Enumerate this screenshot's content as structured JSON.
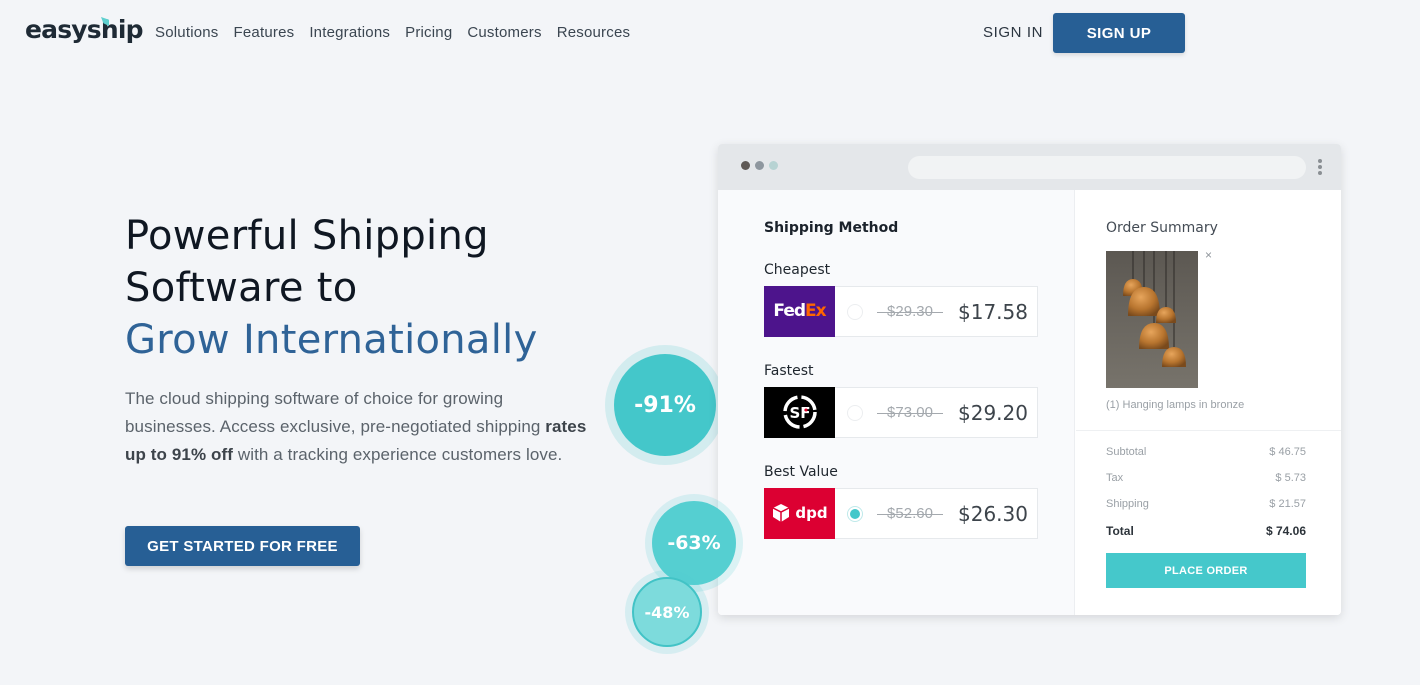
{
  "nav": {
    "logo": "easyship",
    "links": [
      "Solutions",
      "Features",
      "Integrations",
      "Pricing",
      "Customers",
      "Resources"
    ],
    "sign_in": "SIGN IN",
    "sign_up": "SIGN UP"
  },
  "hero": {
    "title_line1": "Powerful Shipping",
    "title_line2": "Software to",
    "title_line3": "Grow Internationally",
    "desc_part1": "The cloud shipping software of choice for growing businesses. Access exclusive, pre-negotiated shipping ",
    "desc_bold": "rates up to 91% off",
    "desc_part2": " with a tracking experience customers love.",
    "cta": "GET STARTED FOR FREE"
  },
  "badges": [
    "-91%",
    "-63%",
    "-48%"
  ],
  "shipping_method": {
    "title": "Shipping Method",
    "options": [
      {
        "label": "Cheapest",
        "carrier": "FedEx",
        "carrier_color": "#4d148c",
        "old_price": "$29.30",
        "price": "$17.58",
        "selected": false
      },
      {
        "label": "Fastest",
        "carrier": "SF",
        "carrier_color": "#000000",
        "old_price": "$73.00",
        "price": "$29.20",
        "selected": false
      },
      {
        "label": "Best Value",
        "carrier": "dpd",
        "carrier_color": "#dc0032",
        "old_price": "$52.60",
        "price": "$26.30",
        "selected": true
      }
    ]
  },
  "order_summary": {
    "title": "Order Summary",
    "close": "×",
    "item_caption": "(1) Hanging lamps in bronze",
    "lines": [
      {
        "label": "Subtotal",
        "value": "$ 46.75"
      },
      {
        "label": "Tax",
        "value": "$ 5.73"
      },
      {
        "label": "Shipping",
        "value": "$ 21.57"
      },
      {
        "label": "Total",
        "value": "$ 74.06"
      }
    ],
    "place_order": "PLACE ORDER"
  },
  "colors": {
    "primary": "#275f95",
    "accent": "#45c8cb",
    "heading_accent": "#2f6397"
  }
}
